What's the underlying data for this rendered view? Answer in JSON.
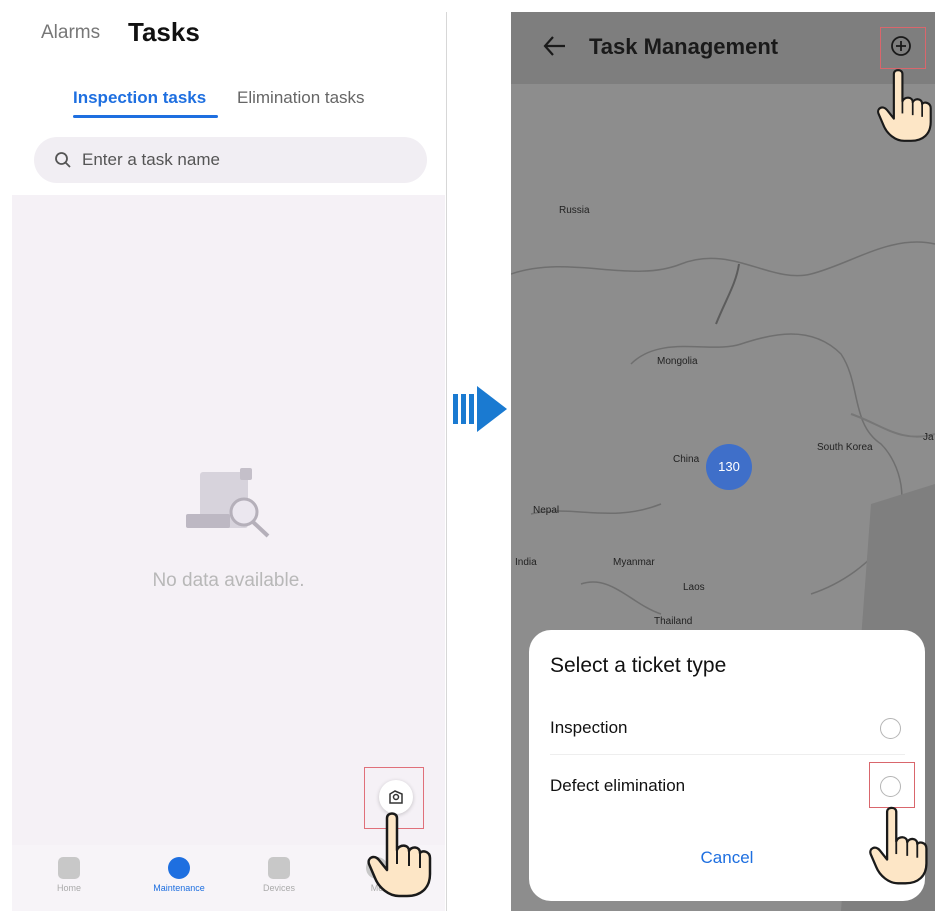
{
  "left_screen": {
    "header": {
      "alarms_label": "Alarms",
      "tasks_label": "Tasks"
    },
    "tabs": [
      {
        "label": "Inspection tasks",
        "active": true
      },
      {
        "label": "Elimination tasks",
        "active": false
      }
    ],
    "search": {
      "placeholder": "Enter a task name"
    },
    "empty_state": {
      "text": "No data available."
    },
    "bottom_nav": [
      {
        "label": "Home",
        "active": false
      },
      {
        "label": "Maintenance",
        "active": true
      },
      {
        "label": "Devices",
        "active": false
      },
      {
        "label": "Me",
        "active": false
      }
    ]
  },
  "right_screen": {
    "header": {
      "title": "Task Management"
    },
    "map": {
      "labels": [
        "Russia",
        "Mongolia",
        "China",
        "South Korea",
        "Ja",
        "Nepal",
        "India",
        "Myanmar",
        "Laos",
        "Thailand"
      ],
      "cluster_count": "130"
    },
    "sheet": {
      "title": "Select a ticket type",
      "options": [
        {
          "label": "Inspection",
          "selected": false
        },
        {
          "label": "Defect elimination",
          "selected": false
        }
      ],
      "cancel_label": "Cancel"
    }
  },
  "colors": {
    "accent": "#1e6fe0",
    "cluster": "#3f6fc9",
    "highlight_box": "#d9666c",
    "arrow": "#1a7ad1"
  }
}
